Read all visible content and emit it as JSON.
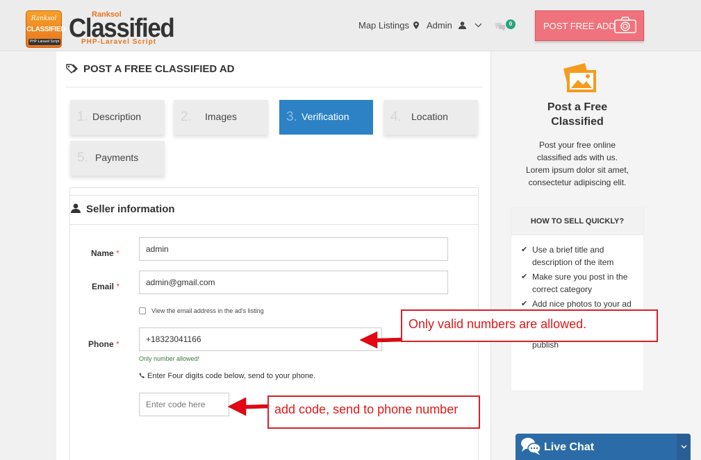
{
  "brand": {
    "badge_top": "Ranksol",
    "badge_main": "CLASSIFIED",
    "badge_footer": "PHP-Laravel Script",
    "small": "Ranksol",
    "big": "Classified",
    "sub": "PHP-Laravel Script"
  },
  "nav": {
    "map_listings": "Map Listings",
    "admin": "Admin",
    "messages_count": "0",
    "post_button": "POST FREE ADD"
  },
  "page": {
    "title": "POST A FREE CLASSIFIED AD"
  },
  "steps": [
    {
      "num": "1.",
      "label": "Description",
      "active": false
    },
    {
      "num": "2.",
      "label": "Images",
      "active": false
    },
    {
      "num": "3.",
      "label": "Verification",
      "active": true
    },
    {
      "num": "4.",
      "label": "Location",
      "active": false
    },
    {
      "num": "5.",
      "label": "Payments",
      "active": false
    }
  ],
  "seller": {
    "title": "Seller information",
    "name_label": "Name",
    "name_value": "admin",
    "email_label": "Email",
    "email_value": "admin@gmail.com",
    "view_email_label": "View the email address in the ad's listing",
    "phone_label": "Phone",
    "phone_value": "+18323041166",
    "phone_help": "Only number allowed!",
    "code_note": "Enter Four digits code below, send to your phone.",
    "code_placeholder": "Enter code here",
    "required_mark": "*"
  },
  "sidebar": {
    "title_line1": "Post a Free",
    "title_line2": "Classified",
    "desc": [
      "Post your free online",
      "classified ads with us.",
      "Lorem ipsum dolor sit amet,",
      "consectetur adipiscing elit."
    ],
    "howto_title": "HOW TO SELL QUICKLY?",
    "tips": [
      [
        "Use a brief title and",
        "description of the item"
      ],
      [
        "Make sure you post in the",
        "correct category"
      ],
      [
        "Add nice photos to your ad"
      ]
    ],
    "tip_tail": "publish"
  },
  "annotations": {
    "phone": "Only valid numbers are allowed.",
    "code": "add code, send to phone number"
  },
  "livechat": {
    "label": "Live Chat"
  },
  "colors": {
    "accent_blue": "#2c82c5",
    "post_button": "#f0727c",
    "brand_orange": "#e8741e",
    "annotation_red": "#d81e2c"
  }
}
